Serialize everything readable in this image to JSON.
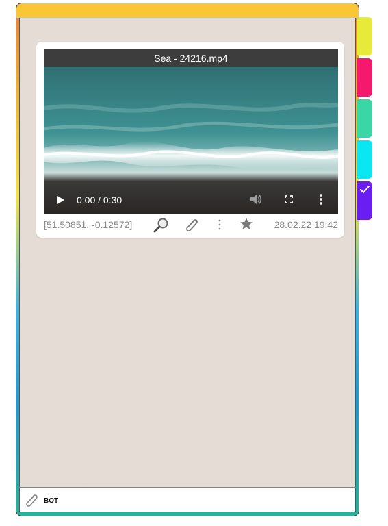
{
  "message": {
    "video_title": "Sea - 24216.mp4",
    "timecode": "0:00 / 0:30",
    "coordinates": "[51.50851, -0.12572]",
    "date": "28.02.22 19:42",
    "progress": 0
  },
  "composer": {
    "author_label": "BOT"
  },
  "tabs": [
    {
      "color": "#e8ea3a",
      "icon": ""
    },
    {
      "color": "#f4196d",
      "icon": ""
    },
    {
      "color": "#3bd6a5",
      "icon": ""
    },
    {
      "color": "#0ae6f2",
      "icon": ""
    },
    {
      "color": "#6a1ef2",
      "icon": "check-icon"
    }
  ],
  "icons": {
    "play": "play-icon",
    "volume": "volume-icon",
    "fullscreen": "fullscreen-icon",
    "more": "more-vertical-icon",
    "search": "magnifier-icon",
    "attach": "paperclip-icon",
    "menu": "more-vertical-icon",
    "favorite": "star-icon"
  }
}
